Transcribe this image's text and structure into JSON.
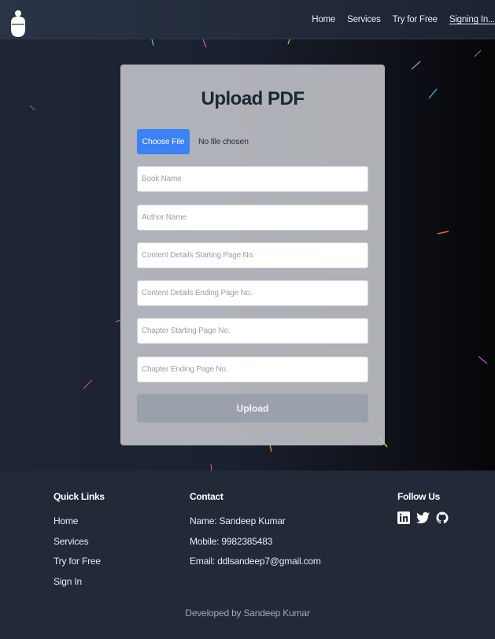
{
  "header": {
    "logo_icon": "lightbulb-icon",
    "nav": {
      "home": "Home",
      "services": "Services",
      "try_free": "Try for Free",
      "signing_in": "Signing In..."
    }
  },
  "upload_form": {
    "title": "Upload PDF",
    "choose_file_label": "Choose File",
    "file_status": "No file chosen",
    "placeholders": {
      "book_name": "Book Name",
      "author_name": "Author Name",
      "content_start": "Content Details Starting Page No.",
      "content_end": "Content Details Ending Page No.",
      "chapter_start": "Chapter Starting Page No.",
      "chapter_end": "Chapter Ending Page No."
    },
    "upload_label": "Upload"
  },
  "footer": {
    "quick_links": {
      "heading": "Quick Links",
      "home": "Home",
      "services": "Services",
      "try_free": "Try for Free",
      "sign_in": "Sign In"
    },
    "contact": {
      "heading": "Contact",
      "name": "Name: Sandeep Kumar",
      "mobile": "Mobile: 9982385483",
      "email": "Email: ddlsandeep7@gmail.com"
    },
    "follow": {
      "heading": "Follow Us",
      "icons": [
        "linkedin-icon",
        "twitter-icon",
        "github-icon"
      ]
    },
    "credit": "Developed by Sandeep Kumar"
  },
  "colors": {
    "accent_blue": "#3b82f6",
    "card_bg": "#c4c6cb",
    "upload_disabled": "#9aa1ad",
    "footer_bg": "#222a38"
  }
}
